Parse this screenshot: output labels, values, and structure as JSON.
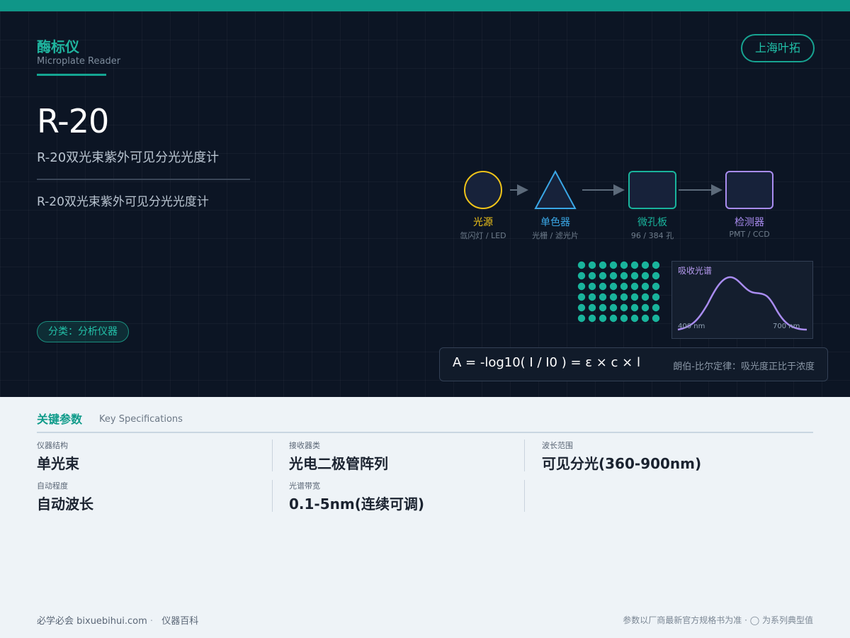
{
  "header": {
    "category_zh": "酶标仪",
    "category_en": "Microplate Reader",
    "brand": "上海叶拓",
    "model": "R-20",
    "subtitle": "R-20双光束紫外可见分光光度计",
    "description": "R-20双光束紫外可见分光光度计",
    "tag": "分类：分析仪器"
  },
  "diagram": {
    "stages": [
      {
        "name": "光源",
        "sub": "氙闪灯 / LED",
        "color": "#f0c419"
      },
      {
        "name": "单色器",
        "sub": "光栅 / 滤光片",
        "color": "#3aa7e6"
      },
      {
        "name": "微孔板",
        "sub": "96 / 384 孔",
        "color": "#19b49c"
      },
      {
        "name": "检测器",
        "sub": "PMT / CCD",
        "color": "#a98cf0"
      }
    ],
    "spectrum_title": "吸收光谱",
    "spectrum_axis_left": "400 nm",
    "spectrum_axis_right": "700 nm",
    "formula": "A = -log10( I / I0 ) = ε × c × l",
    "formula_note": "朗伯-比尔定律：吸光度正比于浓度"
  },
  "specs": {
    "title_zh": "关键参数",
    "title_en": "Key Specifications",
    "items": [
      {
        "label": "仪器结构",
        "value": "单光束"
      },
      {
        "label": "接收器类",
        "value": "光电二极管阵列"
      },
      {
        "label": "波长范围",
        "value": "可见分光(360-900nm)"
      },
      {
        "label": "自动程度",
        "value": "自动波长"
      },
      {
        "label": "光谱带宽",
        "value": "0.1-5nm(连续可调)"
      }
    ]
  },
  "footer": {
    "site": "必学必会 bixuebihui.com",
    "section": "仪器百科",
    "note": "参数以厂商最新官方规格书为准 ·  ◯ 为系列典型值"
  },
  "colors": {
    "accent": "#0f9688",
    "hero_bg": "#0c1524"
  }
}
